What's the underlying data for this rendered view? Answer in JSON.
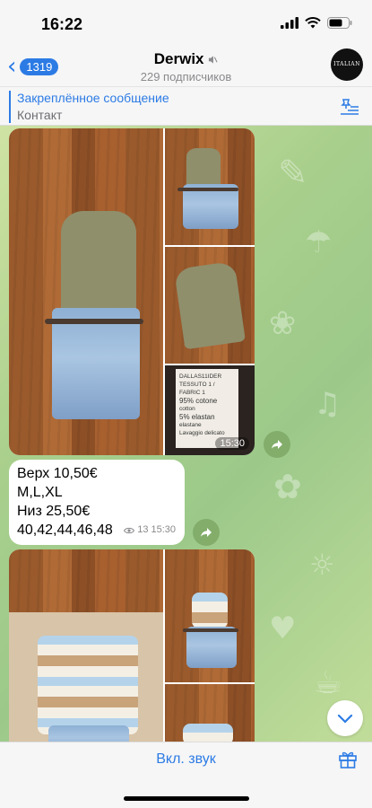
{
  "status_bar": {
    "time": "16:22"
  },
  "header": {
    "back_count": "1319",
    "channel_name": "Derwix",
    "subtitle": "229 подписчиков",
    "avatar_text": "ITALIAN STYLE"
  },
  "pinned": {
    "title": "Закреплённое сообщение",
    "text": "Контакт"
  },
  "album1": {
    "label_lines": [
      "DALLAS11IDER",
      "TESSUTO 1 / FABRIC 1",
      "95% cotone",
      "cotton",
      "5% elastan",
      "elastane",
      "Lavaggio delicato"
    ],
    "timestamp_overlay": "15:30"
  },
  "message": {
    "lines": [
      "Верх 10,50€",
      "M,L,XL",
      "Низ 25,50€",
      "40,42,44,46,48"
    ],
    "views": "13",
    "time": "15:30"
  },
  "bottom_bar": {
    "unmute_label": "Вкл. звук"
  },
  "colors": {
    "accent": "#2c7be5",
    "header_bg": "#f6f6f6",
    "chat_bg": "#a9cf8c"
  },
  "icons": [
    "signal-icon",
    "wifi-icon",
    "battery-icon",
    "mute-icon",
    "pin-list-icon",
    "share-icon",
    "eye-icon",
    "chevron-down-icon",
    "gift-icon"
  ]
}
